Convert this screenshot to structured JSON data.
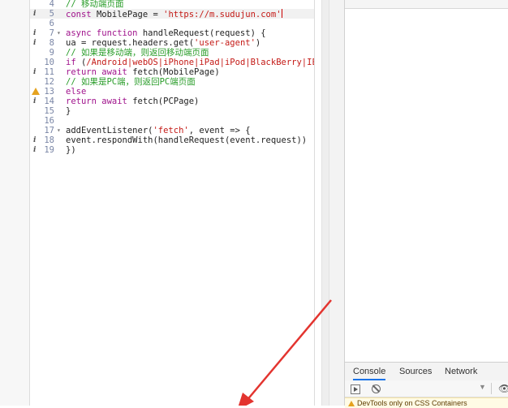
{
  "editor": {
    "lines": [
      {
        "num": "4",
        "icon": "",
        "fold": false,
        "parts": [
          {
            "t": "// 移动端页面",
            "c": "comment"
          }
        ]
      },
      {
        "num": "5",
        "icon": "i",
        "fold": false,
        "active": true,
        "parts": [
          {
            "t": "const ",
            "c": "kw"
          },
          {
            "t": "MobilePage = ",
            "c": ""
          },
          {
            "t": "'https://m.sudujun.com'",
            "c": "str"
          }
        ]
      },
      {
        "num": "6",
        "icon": "",
        "fold": false,
        "parts": []
      },
      {
        "num": "7",
        "icon": "i",
        "fold": true,
        "parts": [
          {
            "t": "async function ",
            "c": "kw"
          },
          {
            "t": "handleRequest(request) {",
            "c": ""
          }
        ]
      },
      {
        "num": "8",
        "icon": "i",
        "fold": false,
        "parts": [
          {
            "t": "ua = request.headers.get(",
            "c": ""
          },
          {
            "t": "'user-agent'",
            "c": "str"
          },
          {
            "t": ")",
            "c": ""
          }
        ]
      },
      {
        "num": "9",
        "icon": "",
        "fold": false,
        "parts": [
          {
            "t": "// 如果是移动端，则返回移动端页面",
            "c": "comment"
          }
        ]
      },
      {
        "num": "10",
        "icon": "",
        "fold": false,
        "parts": [
          {
            "t": "if ",
            "c": "kw"
          },
          {
            "t": "(",
            "c": ""
          },
          {
            "t": "/Android|webOS|iPhone|iPad|iPod|BlackBerry|IEMo",
            "c": "str"
          }
        ]
      },
      {
        "num": "11",
        "icon": "i",
        "fold": false,
        "parts": [
          {
            "t": "return await ",
            "c": "kw"
          },
          {
            "t": "fetch(MobilePage)",
            "c": ""
          }
        ]
      },
      {
        "num": "12",
        "icon": "",
        "fold": false,
        "parts": [
          {
            "t": "// 如果是PC端，则返回PC端页面",
            "c": "comment"
          }
        ]
      },
      {
        "num": "13",
        "icon": "warn",
        "fold": false,
        "parts": [
          {
            "t": "else",
            "c": "kw"
          }
        ]
      },
      {
        "num": "14",
        "icon": "i",
        "fold": false,
        "parts": [
          {
            "t": "return await ",
            "c": "kw"
          },
          {
            "t": "fetch(PCPage)",
            "c": ""
          }
        ]
      },
      {
        "num": "15",
        "icon": "",
        "fold": false,
        "parts": [
          {
            "t": "}",
            "c": ""
          }
        ]
      },
      {
        "num": "16",
        "icon": "",
        "fold": false,
        "parts": []
      },
      {
        "num": "17",
        "icon": "",
        "fold": true,
        "parts": [
          {
            "t": "addEventListener(",
            "c": ""
          },
          {
            "t": "'fetch'",
            "c": "str"
          },
          {
            "t": ", event => {",
            "c": ""
          }
        ]
      },
      {
        "num": "18",
        "icon": "i",
        "fold": false,
        "parts": [
          {
            "t": "event.respondWith(handleRequest(event.request))",
            "c": ""
          }
        ]
      },
      {
        "num": "19",
        "icon": "i",
        "fold": false,
        "parts": [
          {
            "t": "})",
            "c": ""
          }
        ]
      }
    ]
  },
  "devtools": {
    "tabs": [
      {
        "label": "Console",
        "selected": true
      },
      {
        "label": "Sources",
        "selected": false
      },
      {
        "label": "Network",
        "selected": false
      }
    ],
    "message": "DevTools only on CSS Containers"
  },
  "colors": {
    "comment": "#2a9d2a",
    "keyword": "#a0138c",
    "string": "#c41a16",
    "arrow": "#e3342f",
    "tab_accent": "#1a73e8"
  }
}
